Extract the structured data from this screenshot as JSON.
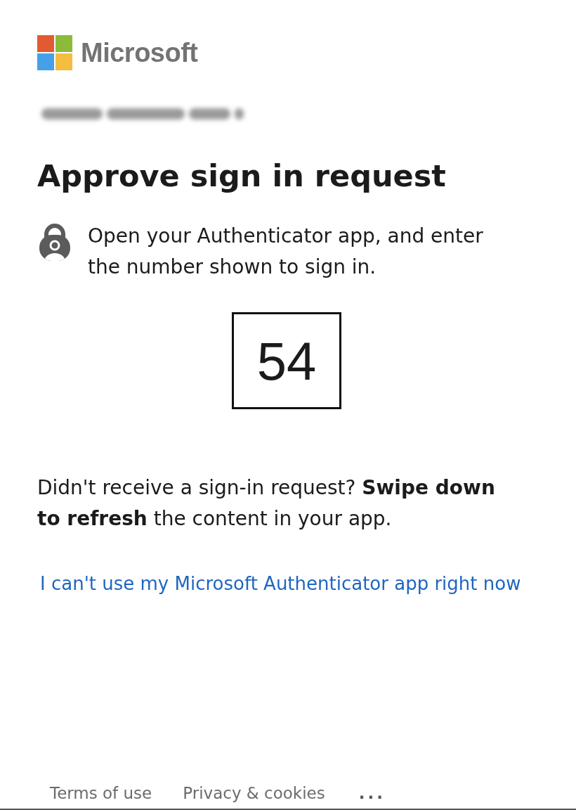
{
  "logo": {
    "wordmark": "Microsoft"
  },
  "account": {
    "email_blurred": true
  },
  "heading": "Approve sign in request",
  "instruction": "Open your Authenticator app, and enter the number shown to sign in.",
  "number": "54",
  "help_text": "Didn't receive a sign-in request? **Swipe down to refresh** the content in your app.",
  "alternative_link": "I can't use my Microsoft Authenticator app right now",
  "footer": {
    "links": [
      "Terms of use",
      "Privacy & cookies"
    ],
    "more": "..."
  }
}
